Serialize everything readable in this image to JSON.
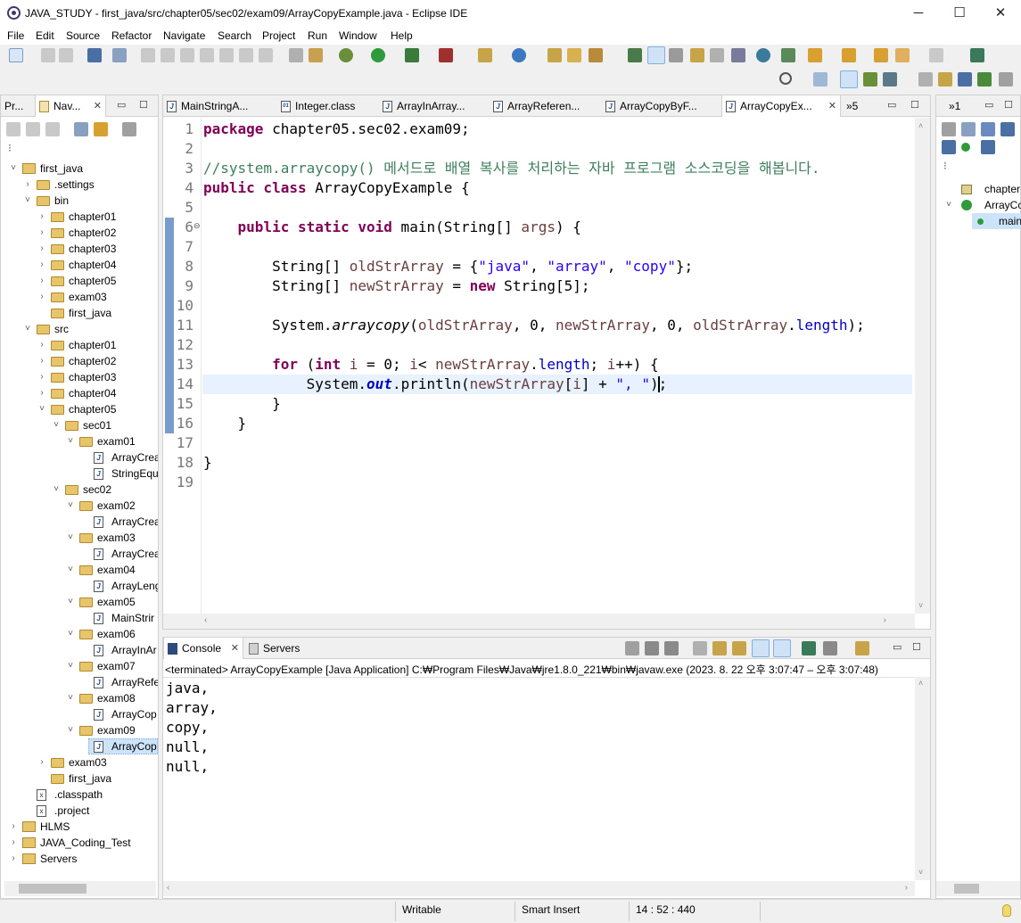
{
  "window": {
    "title": "JAVA_STUDY - first_java/src/chapter05/sec02/exam09/ArrayCopyExample.java - Eclipse IDE",
    "minimize": "─",
    "maximize": "☐",
    "close": "✕"
  },
  "menu": [
    "File",
    "Edit",
    "Source",
    "Refactor",
    "Navigate",
    "Search",
    "Project",
    "Run",
    "Window",
    "Help"
  ],
  "left_panel": {
    "tabs": [
      {
        "label": "Pr..."
      },
      {
        "label": "Nav..."
      }
    ],
    "tree": [
      {
        "label": "first_java",
        "depth": 0,
        "type": "project",
        "open": true
      },
      {
        "label": ".settings",
        "depth": 1,
        "type": "folder",
        "open": false
      },
      {
        "label": "bin",
        "depth": 1,
        "type": "folder",
        "open": true
      },
      {
        "label": "chapter01",
        "depth": 2,
        "type": "folder",
        "open": false
      },
      {
        "label": "chapter02",
        "depth": 2,
        "type": "folder",
        "open": false
      },
      {
        "label": "chapter03",
        "depth": 2,
        "type": "folder",
        "open": false
      },
      {
        "label": "chapter04",
        "depth": 2,
        "type": "folder",
        "open": false
      },
      {
        "label": "chapter05",
        "depth": 2,
        "type": "folder",
        "open": false
      },
      {
        "label": "exam03",
        "depth": 2,
        "type": "folder",
        "open": false
      },
      {
        "label": "first_java",
        "depth": 2,
        "type": "folder",
        "open": null
      },
      {
        "label": "src",
        "depth": 1,
        "type": "folder",
        "open": true
      },
      {
        "label": "chapter01",
        "depth": 2,
        "type": "folder",
        "open": false
      },
      {
        "label": "chapter02",
        "depth": 2,
        "type": "folder",
        "open": false
      },
      {
        "label": "chapter03",
        "depth": 2,
        "type": "folder",
        "open": false
      },
      {
        "label": "chapter04",
        "depth": 2,
        "type": "folder",
        "open": false
      },
      {
        "label": "chapter05",
        "depth": 2,
        "type": "folder",
        "open": true
      },
      {
        "label": "sec01",
        "depth": 3,
        "type": "folder",
        "open": true
      },
      {
        "label": "exam01",
        "depth": 4,
        "type": "folder",
        "open": true
      },
      {
        "label": "ArrayCrea",
        "depth": 5,
        "type": "java",
        "open": null
      },
      {
        "label": "StringEqu",
        "depth": 5,
        "type": "java",
        "open": null
      },
      {
        "label": "sec02",
        "depth": 3,
        "type": "folder",
        "open": true
      },
      {
        "label": "exam02",
        "depth": 4,
        "type": "folder",
        "open": true
      },
      {
        "label": "ArrayCrea",
        "depth": 5,
        "type": "java",
        "open": null
      },
      {
        "label": "exam03",
        "depth": 4,
        "type": "folder",
        "open": true
      },
      {
        "label": "ArrayCrea",
        "depth": 5,
        "type": "java",
        "open": null
      },
      {
        "label": "exam04",
        "depth": 4,
        "type": "folder",
        "open": true
      },
      {
        "label": "ArrayLeng",
        "depth": 5,
        "type": "java",
        "open": null
      },
      {
        "label": "exam05",
        "depth": 4,
        "type": "folder",
        "open": true
      },
      {
        "label": "MainStrir",
        "depth": 5,
        "type": "java",
        "open": null
      },
      {
        "label": "exam06",
        "depth": 4,
        "type": "folder",
        "open": true
      },
      {
        "label": "ArrayInAr",
        "depth": 5,
        "type": "java",
        "open": null
      },
      {
        "label": "exam07",
        "depth": 4,
        "type": "folder",
        "open": true
      },
      {
        "label": "ArrayRefe",
        "depth": 5,
        "type": "java",
        "open": null
      },
      {
        "label": "exam08",
        "depth": 4,
        "type": "folder",
        "open": true
      },
      {
        "label": "ArrayCop",
        "depth": 5,
        "type": "java",
        "open": null
      },
      {
        "label": "exam09",
        "depth": 4,
        "type": "folder",
        "open": true
      },
      {
        "label": "ArrayCop",
        "depth": 5,
        "type": "java",
        "open": null,
        "selected": true
      },
      {
        "label": "exam03",
        "depth": 2,
        "type": "folder",
        "open": false
      },
      {
        "label": "first_java",
        "depth": 2,
        "type": "folder",
        "open": null
      },
      {
        "label": ".classpath",
        "depth": 1,
        "type": "xml",
        "open": null
      },
      {
        "label": ".project",
        "depth": 1,
        "type": "xml",
        "open": null
      },
      {
        "label": "HLMS",
        "depth": 0,
        "type": "project",
        "open": false
      },
      {
        "label": "JAVA_Coding_Test",
        "depth": 0,
        "type": "project",
        "open": false
      },
      {
        "label": "Servers",
        "depth": 0,
        "type": "project",
        "open": false
      }
    ]
  },
  "editor": {
    "tabs": [
      {
        "label": "MainStringA...",
        "icon": "J",
        "active": false
      },
      {
        "label": "Integer.class",
        "icon": "01",
        "active": false
      },
      {
        "label": "ArrayInArray...",
        "icon": "J",
        "active": false
      },
      {
        "label": "ArrayReferen...",
        "icon": "J",
        "active": false
      },
      {
        "label": "ArrayCopyByF...",
        "icon": "J",
        "active": false
      },
      {
        "label": "ArrayCopyEx...",
        "icon": "J",
        "active": true
      }
    ],
    "overflow": "»5",
    "line_numbers": [
      "1",
      "2",
      "3",
      "4",
      "5",
      "6",
      "7",
      "8",
      "9",
      "10",
      "11",
      "12",
      "13",
      "14",
      "15",
      "16",
      "17",
      "18",
      "19"
    ],
    "code": {
      "l1_kw": "package",
      "l1_rest": " chapter05.sec02.exam09;",
      "l3_comment": "//system.arraycopy() 메서드로 배열 복사를 처리하는 자바 프로그램 소스코딩을 해봅니다.",
      "l4_kw": "public class",
      "l4_rest": " ArrayCopyExample {",
      "l6_indent": "    ",
      "l6_kw": "public static void",
      "l6_a": " main(String[] ",
      "l6_var": "args",
      "l6_b": ") {",
      "l8_a": "        String[] ",
      "l8_var": "oldStrArray",
      "l8_b": " = {",
      "l8_s1": "\"java\"",
      "l8_c": ", ",
      "l8_s2": "\"array\"",
      "l8_d": ", ",
      "l8_s3": "\"copy\"",
      "l8_e": "};",
      "l9_a": "        String[] ",
      "l9_var": "newStrArray",
      "l9_b": " = ",
      "l9_kw": "new",
      "l9_c": " String[5];",
      "l11_a": "        System.",
      "l11_m": "arraycopy",
      "l11_b": "(",
      "l11_v1": "oldStrArray",
      "l11_c": ", 0, ",
      "l11_v2": "newStrArray",
      "l11_d": ", 0, ",
      "l11_v3": "oldStrArray",
      "l11_e": ".",
      "l11_f": "length",
      "l11_g": ");",
      "l13_indent": "        ",
      "l13_kw1": "for",
      "l13_a": " (",
      "l13_kw2": "int",
      "l13_b": " ",
      "l13_v1": "i",
      "l13_c": " = 0; ",
      "l13_v2": "i",
      "l13_d": "< ",
      "l13_v3": "newStrArray",
      "l13_e": ".",
      "l13_f": "length",
      "l13_g": "; ",
      "l13_v4": "i",
      "l13_h": "++) {",
      "l14_a": "            System.",
      "l14_out": "out",
      "l14_b": ".println(",
      "l14_v1": "newStrArray",
      "l14_c": "[",
      "l14_v2": "i",
      "l14_d": "] + ",
      "l14_s": "\", \"",
      "l14_e": ");",
      "l15": "        }",
      "l16": "    }",
      "l18": "}"
    }
  },
  "outline_panel": {
    "tab": "»1",
    "items": [
      "chapter",
      "ArrayCo",
      "main"
    ]
  },
  "console": {
    "tabs": [
      {
        "label": "Console"
      },
      {
        "label": "Servers"
      }
    ],
    "header": "<terminated> ArrayCopyExample [Java Application] C:₩Program Files₩Java₩jre1.8.0_221₩bin₩javaw.exe  (2023. 8. 22 오후 3:07:47 – 오후 3:07:48)",
    "output": [
      "java,",
      "array,",
      "copy,",
      "null,",
      "null,"
    ]
  },
  "status": {
    "writable": "Writable",
    "insert_mode": "Smart Insert",
    "position": "14 : 52 : 440"
  },
  "colors": {
    "keyword": "#7f0055",
    "comment": "#3f7f5f",
    "string": "#2a00ff",
    "field": "#0000c0",
    "local_var": "#6a3e3e",
    "current_line": "#e8f2fe",
    "selection": "#cde3fa"
  }
}
